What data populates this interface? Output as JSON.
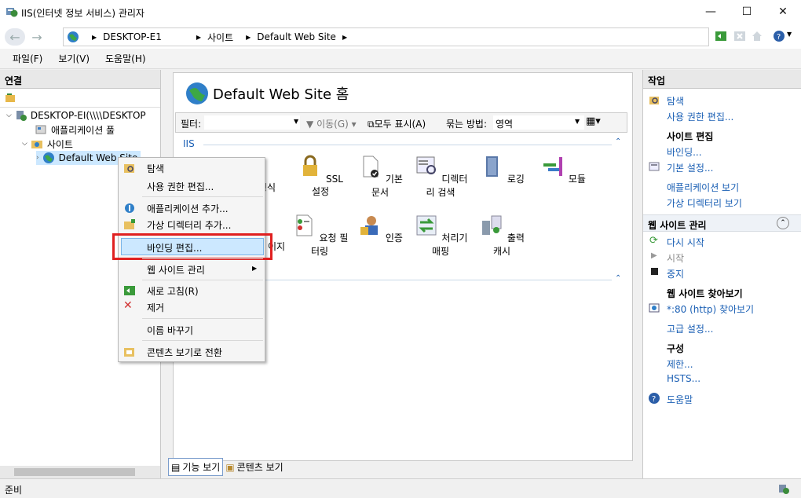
{
  "window": {
    "title": "IIS(인터넷 정보 서비스) 관리자",
    "min": "—",
    "max": "☐",
    "close": "✕"
  },
  "address": {
    "crumbs": [
      "DESKTOP-E1",
      "사이트",
      "Default Web Site"
    ]
  },
  "menu": [
    "파일(F)",
    "보기(V)",
    "도움말(H)"
  ],
  "connections": {
    "header": "연결",
    "tree": {
      "server": "DESKTOP-EI(\\\\\\\\DESKTOP",
      "app_pools": "애플리케이션 풀",
      "sites": "사이트",
      "default_site": "Default Web Site"
    }
  },
  "center": {
    "title": "Default Web Site 홈",
    "filter_label": "필터:",
    "go_label": "이동(G)",
    "show_all": "모두 표시(A)",
    "group_by_label": "묶는 방법:",
    "group_by_value": "영역",
    "group_name": "IIS",
    "features_row1": [
      "SSL 설정",
      "기본 문서",
      "디렉터리 검색",
      "로깅",
      "모듈"
    ],
    "features_row2": [
      "요청 필터링",
      "인증",
      "처리기 매핑",
      "출력 캐시"
    ],
    "partial_row1": "형식",
    "partial_row2": "이지",
    "tabs": {
      "features": "기능 보기",
      "content": "콘텐츠 보기"
    }
  },
  "actions": {
    "header": "작업",
    "explore": "탐색",
    "edit_perms": "사용 권한 편집...",
    "site_edit_header": "사이트 편집",
    "bindings": "바인딩...",
    "basic_settings": "기본 설정...",
    "view_apps": "애플리케이션 보기",
    "view_vdirs": "가상 디렉터리 보기",
    "manage_header": "웹 사이트 관리",
    "restart": "다시 시작",
    "start": "시작",
    "stop": "중지",
    "browse_header": "웹 사이트 찾아보기",
    "browse_80": "*:80 (http) 찾아보기",
    "advanced": "고급 설정...",
    "config_header": "구성",
    "limits": "제한...",
    "hsts": "HSTS...",
    "help": "도움말"
  },
  "context_menu": {
    "explore": "탐색",
    "edit_perms": "사용 권한 편집...",
    "add_app": "애플리케이션 추가...",
    "add_vdir": "가상 디렉터리 추가...",
    "edit_bindings": "바인딩 편집...",
    "manage_site": "웹 사이트 관리",
    "refresh": "새로 고침(R)",
    "remove": "제거",
    "rename": "이름 바꾸기",
    "switch_content": "콘텐츠 보기로 전환"
  },
  "status": {
    "text": "준비"
  },
  "colors": {
    "link": "#1a5fb4",
    "highlight": "#cce8ff",
    "annotation": "#e02020"
  }
}
